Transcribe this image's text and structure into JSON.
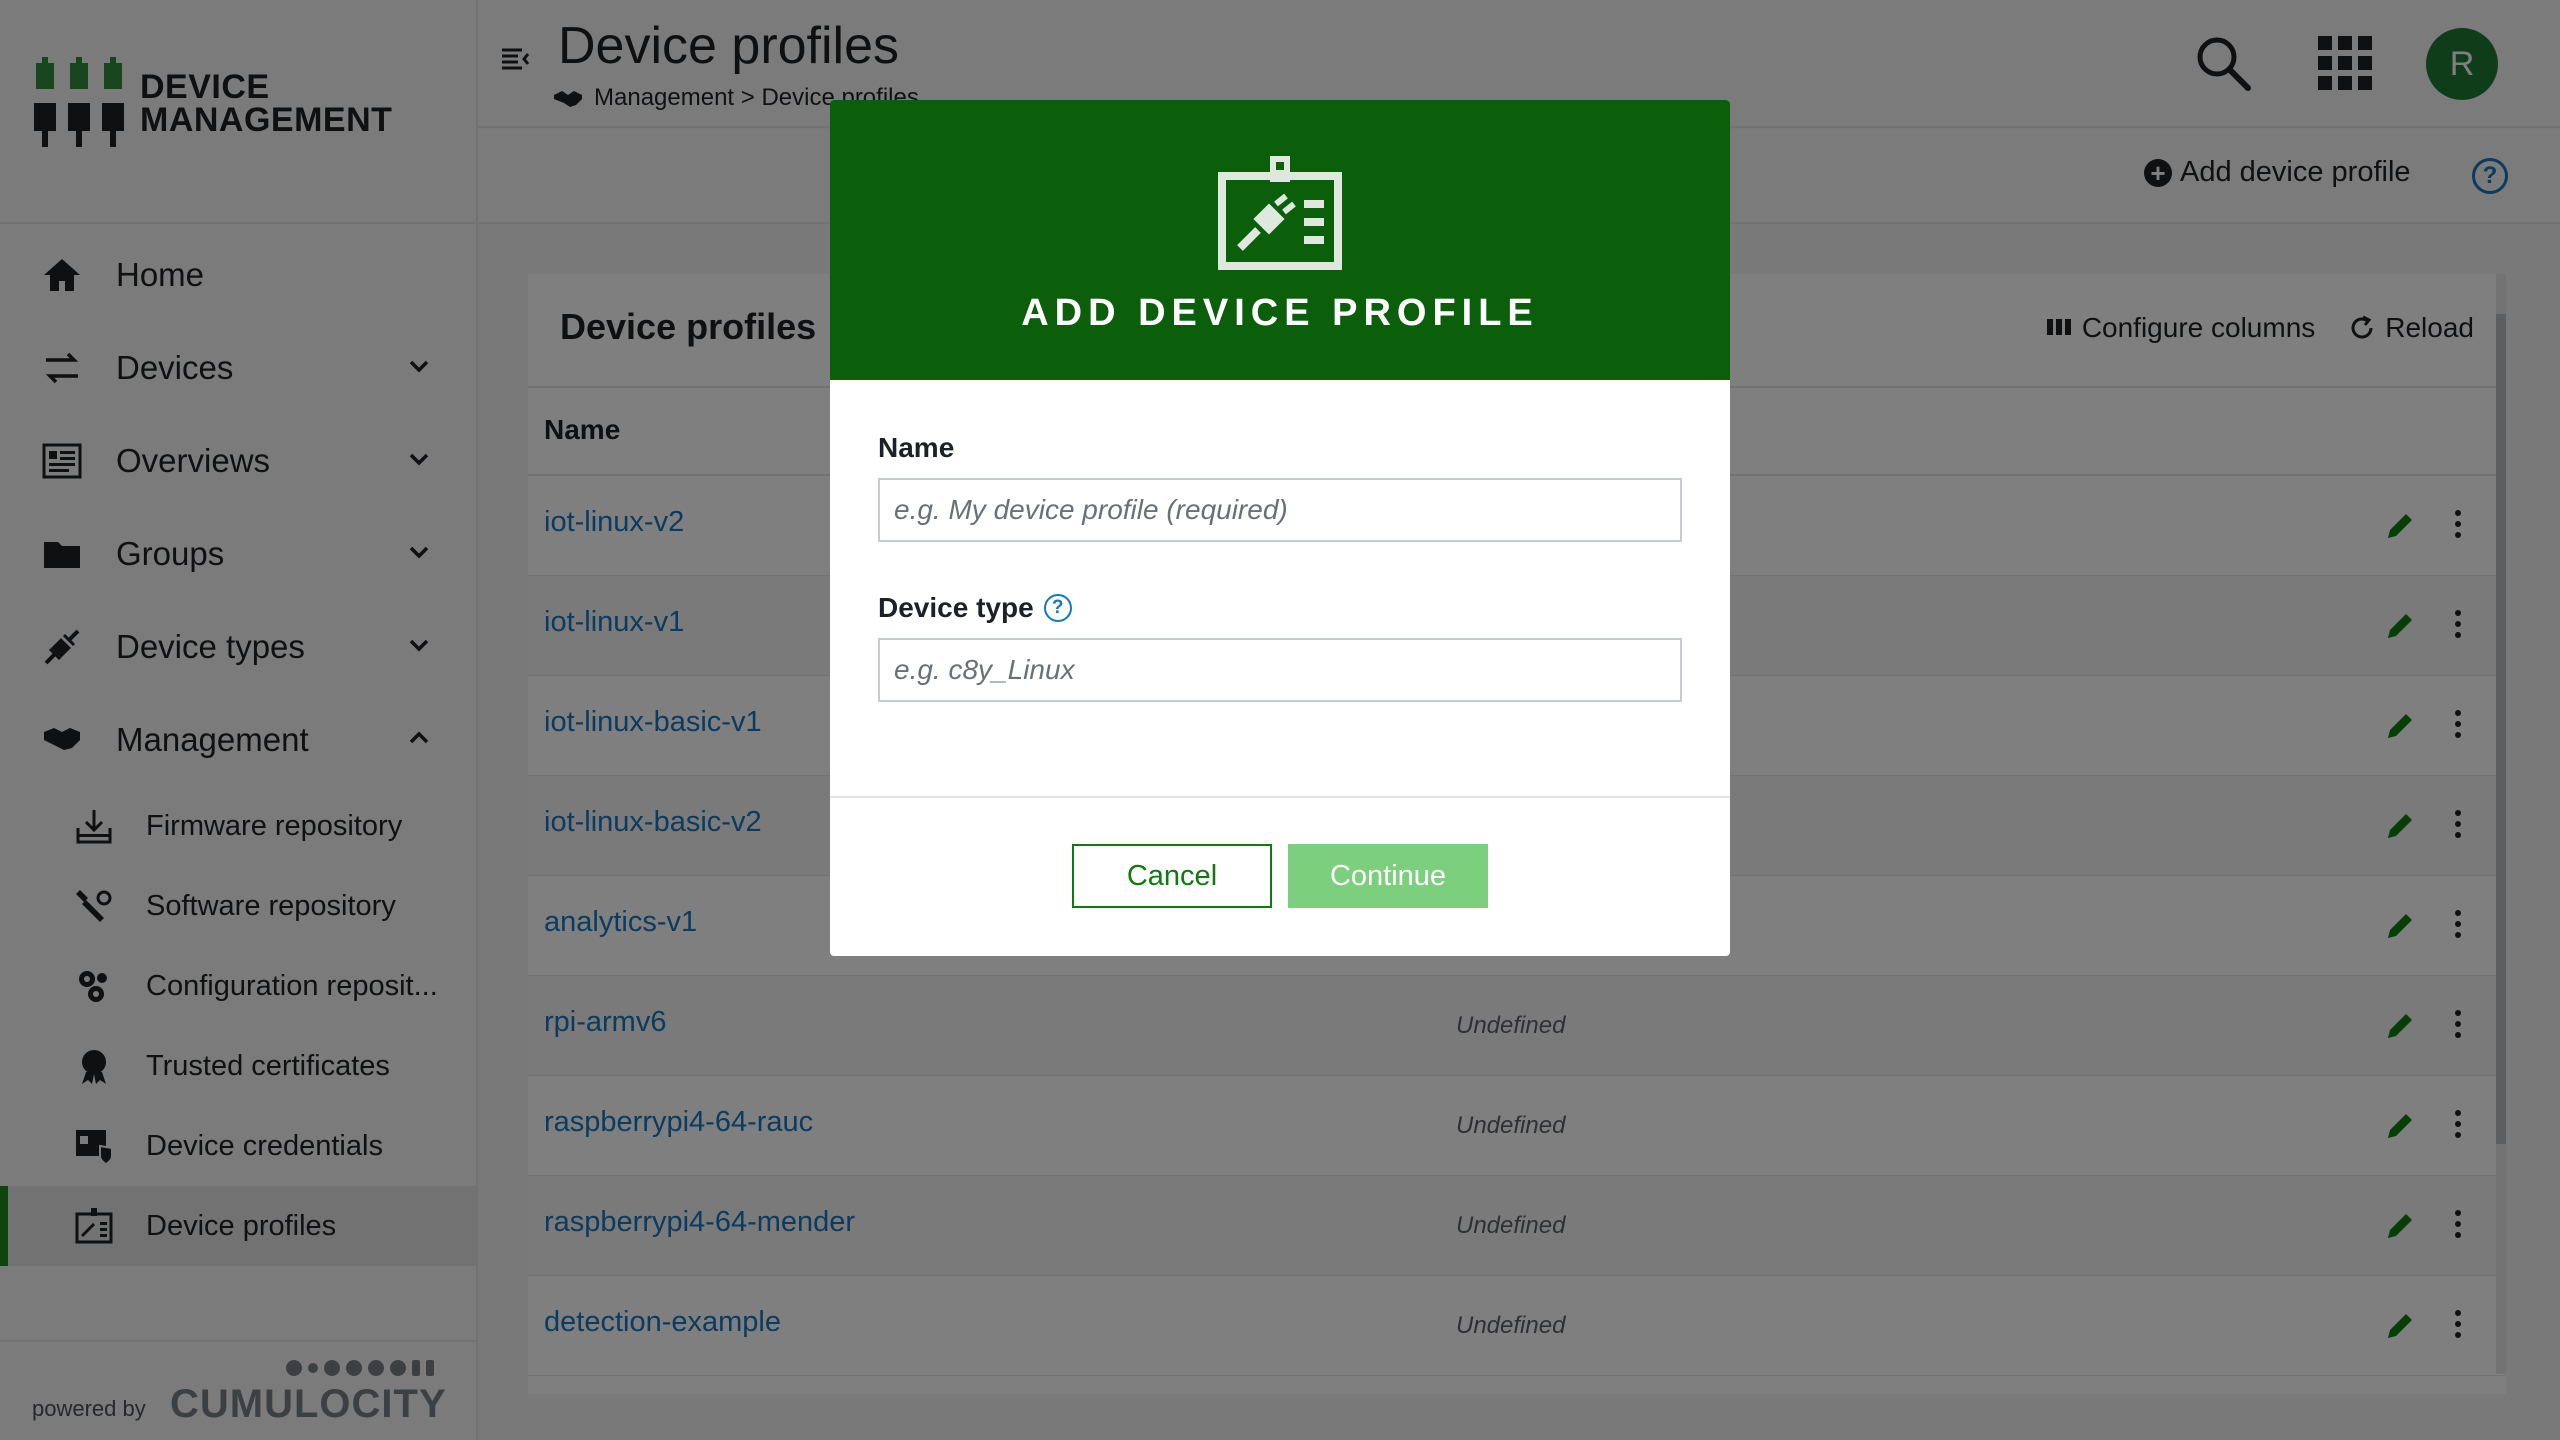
{
  "brand": {
    "line1": "DEVICE",
    "line2": "MANAGEMENT",
    "logo": "device-management-logo"
  },
  "nav": {
    "home": "Home",
    "devices": "Devices",
    "overviews": "Overviews",
    "groups": "Groups",
    "device_types": "Device types",
    "management": "Management",
    "sub": {
      "firmware": "Firmware repository",
      "software": "Software repository",
      "configuration": "Configuration reposit...",
      "certificates": "Trusted certificates",
      "credentials": "Device credentials",
      "profiles": "Device profiles"
    }
  },
  "footer": {
    "powered_by": "powered by",
    "company": "CUMULOCITY"
  },
  "header": {
    "title": "Device profiles",
    "breadcrumb": "Management > Device profiles",
    "avatar_initial": "R"
  },
  "actionbar": {
    "add_label": "Add device profile"
  },
  "card": {
    "title": "Device profiles",
    "configure_columns": "Configure columns",
    "reload": "Reload",
    "col_name": "Name"
  },
  "rows": [
    {
      "name": "iot-linux-v2",
      "type": ""
    },
    {
      "name": "iot-linux-v1",
      "type": ""
    },
    {
      "name": "iot-linux-basic-v1",
      "type": ""
    },
    {
      "name": "iot-linux-basic-v2",
      "type": ""
    },
    {
      "name": "analytics-v1",
      "type": ""
    },
    {
      "name": "rpi-armv6",
      "type": "Undefined"
    },
    {
      "name": "raspberrypi4-64-rauc",
      "type": "Undefined"
    },
    {
      "name": "raspberrypi4-64-mender",
      "type": "Undefined"
    },
    {
      "name": "detection-example",
      "type": "Undefined"
    }
  ],
  "modal": {
    "title": "ADD DEVICE PROFILE",
    "name_label": "Name",
    "name_placeholder": "e.g. My device profile (required)",
    "type_label": "Device type",
    "type_placeholder": "e.g. c8y_Linux",
    "help_glyph": "?",
    "cancel": "Cancel",
    "continue": "Continue"
  },
  "colors": {
    "brand_green": "#0b5f0b",
    "accent_green": "#1a8a1a",
    "continue_disabled": "#7ccf7c",
    "link_blue": "#1776bf",
    "overlay": "rgba(0,0,0,0.5)"
  }
}
